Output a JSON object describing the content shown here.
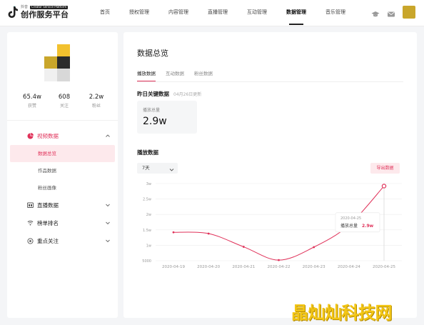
{
  "brand": {
    "small_text": "抖音",
    "small_badge": "Creator Service Platform",
    "title": "创作服务平台"
  },
  "nav": {
    "items": [
      {
        "label": "首页",
        "active": false
      },
      {
        "label": "授权管理",
        "active": false
      },
      {
        "label": "内容管理",
        "active": false
      },
      {
        "label": "直播管理",
        "active": false
      },
      {
        "label": "互动管理",
        "active": false
      },
      {
        "label": "数据管理",
        "active": true
      },
      {
        "label": "音乐管理",
        "active": false
      }
    ],
    "icons": [
      "graduation-cap-icon",
      "mail-icon"
    ]
  },
  "profile": {
    "stats": [
      {
        "value": "65.4w",
        "label": "获赞"
      },
      {
        "value": "608",
        "label": "关注"
      },
      {
        "value": "2.2w",
        "label": "粉丝"
      }
    ]
  },
  "sidebar": {
    "groups": [
      {
        "label": "视频数据",
        "icon": "pie-chart-icon",
        "open": true,
        "items": [
          {
            "label": "数据总览",
            "active": true
          },
          {
            "label": "作品数据",
            "active": false
          },
          {
            "label": "粉丝画像",
            "active": false
          }
        ]
      },
      {
        "label": "直播数据",
        "icon": "live-screen-icon",
        "open": false
      },
      {
        "label": "榜单排名",
        "icon": "ranking-icon",
        "open": false
      },
      {
        "label": "重点关注",
        "icon": "target-icon",
        "open": false
      }
    ]
  },
  "main": {
    "title": "数据总览",
    "tabs": [
      {
        "label": "播放数据",
        "active": true
      },
      {
        "label": "互动数据",
        "active": false
      },
      {
        "label": "粉丝数据",
        "active": false
      }
    ],
    "yesterday": {
      "title": "昨日关键数据",
      "updated": "04月26日更新",
      "kpi_label": "播放总量",
      "kpi_value": "2.9w"
    },
    "play": {
      "title": "播放数据",
      "range_select": "7天",
      "export_label": "导出数据"
    }
  },
  "chart_data": {
    "type": "line",
    "x": [
      "2020-04-19",
      "2020-04-20",
      "2020-04-21",
      "2020-04-22",
      "2020-04-23",
      "2020-04-24",
      "2020-04-25"
    ],
    "series": [
      {
        "name": "播放总量",
        "values": [
          14200,
          13800,
          9500,
          5200,
          9400,
          16500,
          29200
        ]
      }
    ],
    "y_ticks": [
      "3w",
      "2.5w",
      "2w",
      "1.5w",
      "1w",
      "5000"
    ],
    "ylim": [
      5000,
      30000
    ],
    "grid": true,
    "color": "#e0325a",
    "tooltip": {
      "date": "2020-04-25",
      "label": "播放总量",
      "value": "2.9w"
    }
  },
  "watermark": "晶灿灿科技网"
}
